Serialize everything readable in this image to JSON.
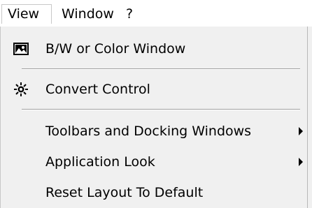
{
  "menubar": {
    "items": [
      {
        "label": "View"
      },
      {
        "label": "Window"
      },
      {
        "label": "?"
      }
    ]
  },
  "view_menu": {
    "items": [
      {
        "label": "B/W or Color Window",
        "icon": "image-icon"
      },
      {
        "label": "Convert Control",
        "icon": "sun-icon"
      },
      {
        "label": "Toolbars and Docking Windows",
        "submenu": true
      },
      {
        "label": "Application Look",
        "submenu": true
      },
      {
        "label": "Reset Layout To Default"
      }
    ]
  }
}
